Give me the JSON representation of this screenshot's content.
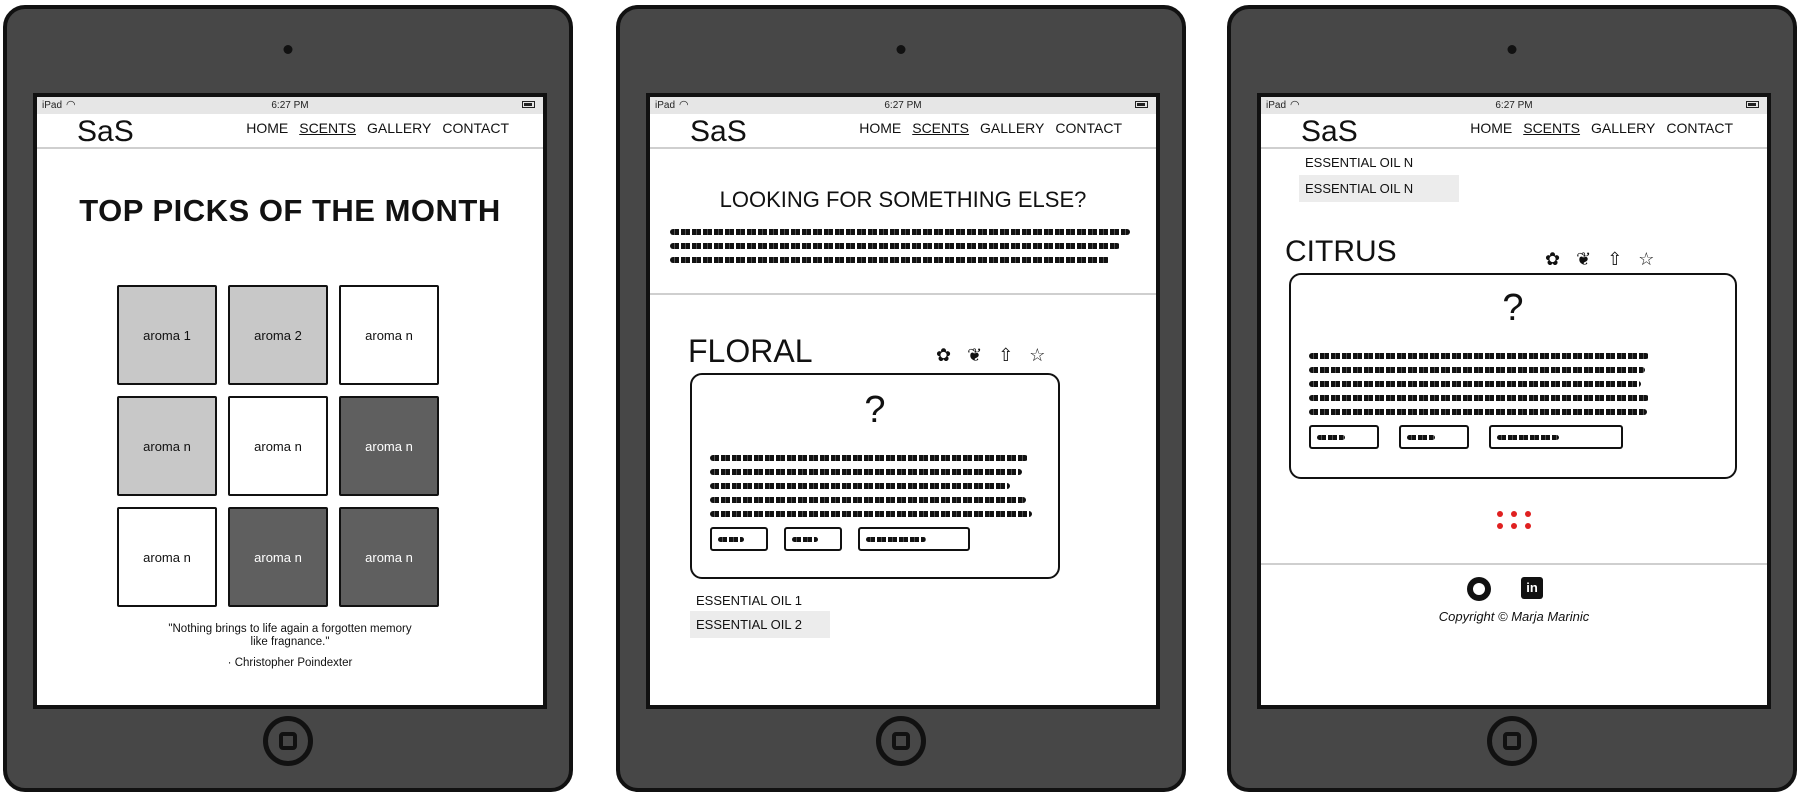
{
  "status": {
    "device": "iPad",
    "wifi": "wifi-icon",
    "time": "6:27 PM",
    "battery": "battery-icon"
  },
  "nav": {
    "logo": "SaS",
    "items": [
      "HOME",
      "SCENTS",
      "GALLERY",
      "CONTACT"
    ],
    "active": "SCENTS"
  },
  "screen1": {
    "title": "TOP PICKS OF THE MONTH",
    "tiles": [
      {
        "label": "aroma 1",
        "tone": "light"
      },
      {
        "label": "aroma 2",
        "tone": "light"
      },
      {
        "label": "aroma n",
        "tone": "white"
      },
      {
        "label": "aroma n",
        "tone": "light"
      },
      {
        "label": "aroma n",
        "tone": "white"
      },
      {
        "label": "aroma n",
        "tone": "dark"
      },
      {
        "label": "aroma n",
        "tone": "white"
      },
      {
        "label": "aroma n",
        "tone": "dark"
      },
      {
        "label": "aroma n",
        "tone": "dark"
      }
    ],
    "quote_line1": "\"Nothing brings to life again a forgotten memory",
    "quote_line2": "like fragnance.\"",
    "author": "·  Christopher Poindexter"
  },
  "screen2": {
    "heading": "LOOKING FOR SOMETHING ELSE?",
    "category": "FLORAL",
    "icons": [
      "flower-icon",
      "leaf-icon",
      "tree-icon",
      "star-icon"
    ],
    "card_symbol": "?",
    "oils": [
      "ESSENTIAL OIL 1",
      "ESSENTIAL OIL 2"
    ]
  },
  "screen3": {
    "oils": [
      "ESSENTIAL OIL N",
      "ESSENTIAL OIL N"
    ],
    "category": "CITRUS",
    "icons": [
      "flower-icon",
      "leaf-icon",
      "tree-icon",
      "star-icon"
    ],
    "card_symbol": "?",
    "dots": "loading-dots",
    "footer_icons": [
      "github-icon",
      "linkedin-icon"
    ],
    "copyright": "Copyright © Marja Marinic"
  }
}
